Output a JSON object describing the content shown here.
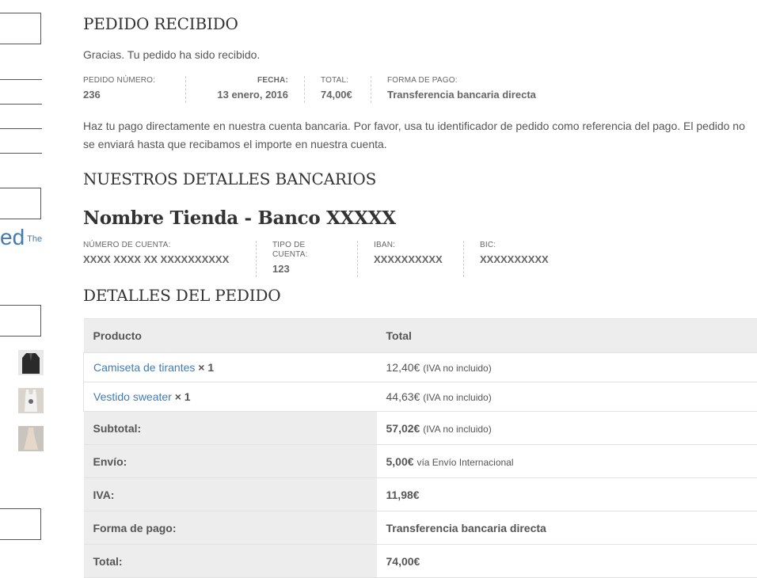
{
  "sidebar": {
    "ed_text": "ed",
    "the_text": "The",
    "thumbnails": [
      "jacket-thumbnail",
      "tank-top-thumbnail",
      "dress-thumbnail"
    ]
  },
  "order_received": {
    "title": "PEDIDO RECIBIDO",
    "thanks": "Gracias. Tu pedido ha sido recibido.",
    "meta": {
      "order_number_label": "Pedido número:",
      "order_number": "236",
      "date_label": "Fecha:",
      "date": "13 enero, 2016",
      "total_label": "Total:",
      "total": "74,00€",
      "payment_label": "Forma de pago:",
      "payment": "Transferencia bancaria directa"
    },
    "instructions": "Haz tu pago directamente en nuestra cuenta bancaria. Por favor, usa tu identificador de pedido como referencia del pago. El pedido no se enviará hasta que recibamos el importe en nuestra cuenta."
  },
  "bank_details": {
    "title": "NUESTROS DETALLES BANCARIOS",
    "bank_name": "Nombre Tienda - Banco XXXXX",
    "account_number_label": "Número de cuenta:",
    "account_number": "XXXX XXXX XX XXXXXXXXXX",
    "account_type_label": "Tipo de cuenta:",
    "account_type": "123",
    "iban_label": "IBAN:",
    "iban": "XXXXXXXXXX",
    "bic_label": "BIC:",
    "bic": "XXXXXXXXXX"
  },
  "order_details": {
    "title": "DETALLES DEL PEDIDO",
    "col_product": "Producto",
    "col_total": "Total",
    "items": [
      {
        "name": "Camiseta de tirantes",
        "qty": "× 1",
        "price": "12,40€",
        "tax_note": "(IVA no incluido)"
      },
      {
        "name": "Vestido sweater",
        "qty": "× 1",
        "price": "44,63€",
        "tax_note": "(IVA no incluido)"
      }
    ],
    "subtotal_label": "Subtotal:",
    "subtotal": "57,02€",
    "subtotal_note": "(IVA no incluido)",
    "shipping_label": "Envío:",
    "shipping": "5,00€",
    "shipping_note": "vía Envío Internacional",
    "tax_label": "IVA:",
    "tax": "11,98€",
    "payment_label": "Forma de pago:",
    "payment": "Transferencia bancaria directa",
    "total_label": "Total:",
    "total": "74,00€"
  }
}
